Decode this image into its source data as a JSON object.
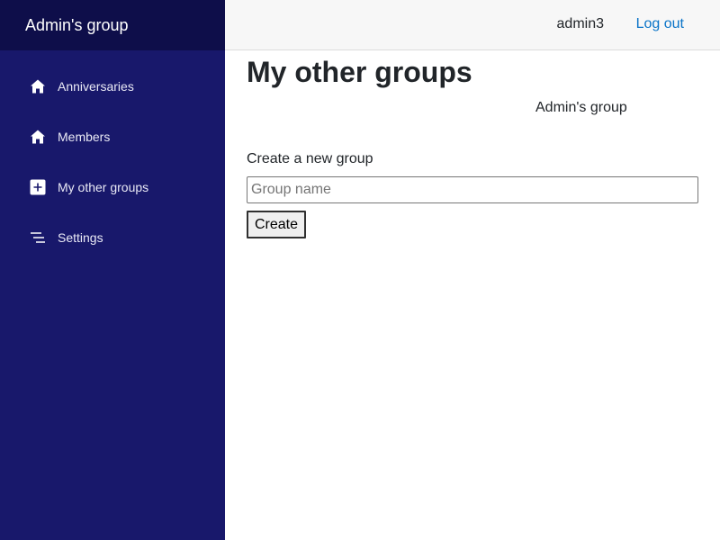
{
  "sidebar": {
    "brand": "Admin's group",
    "items": [
      {
        "label": "Anniversaries",
        "icon": "home-icon"
      },
      {
        "label": "Members",
        "icon": "home-icon"
      },
      {
        "label": "My other groups",
        "icon": "plus-square-icon"
      },
      {
        "label": "Settings",
        "icon": "menu-lines-icon"
      }
    ]
  },
  "topbar": {
    "username": "admin3",
    "logout_label": "Log out"
  },
  "main": {
    "title": "My other groups",
    "groups": [
      "Admin's group"
    ],
    "create_label": "Create a new group",
    "input_placeholder": "Group name",
    "input_value": "",
    "create_button": "Create"
  },
  "colors": {
    "sidebar_bg": "#18186b",
    "brand_bg": "#0e0e4a",
    "link": "#0a74c8",
    "topbar_bg": "#f7f7f7"
  }
}
